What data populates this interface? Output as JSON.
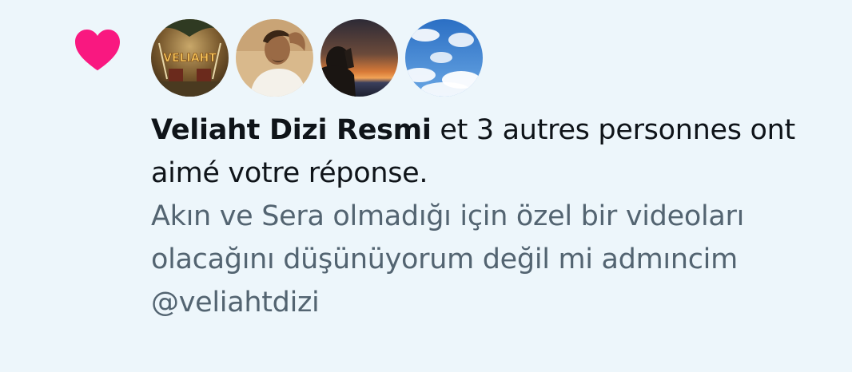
{
  "notification": {
    "type": "like",
    "icon": "heart-icon",
    "icon_color": "#f91880",
    "avatars": [
      {
        "label": "VELIAHT",
        "icon": "veliaht-avatar"
      },
      {
        "icon": "man-portrait-avatar"
      },
      {
        "icon": "sunset-silhouette-avatar"
      },
      {
        "icon": "sky-clouds-avatar"
      }
    ],
    "actor_name": "Veliaht Dizi Resmi",
    "summary_rest": " et 3 autres personnes ont aimé votre réponse.",
    "reply_text": "Akın ve Sera olmadığı için özel bir videoları olacağını düşünüyorum değil mi admıncim @veliahtdizi"
  },
  "colors": {
    "background": "#edf6fb",
    "primary_text": "#0f1419",
    "secondary_text": "#536471",
    "like": "#f91880"
  }
}
